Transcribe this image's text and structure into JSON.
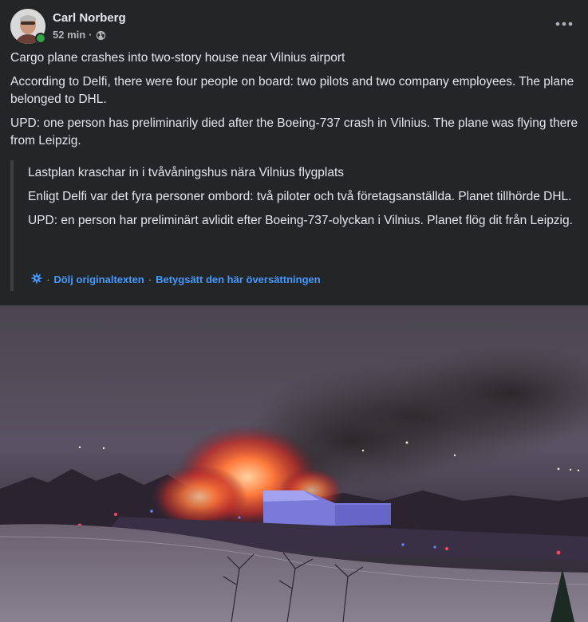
{
  "post": {
    "author": "Carl Norberg",
    "time": "52 min",
    "separator": "·",
    "privacy_icon": "globe-icon",
    "more_icon": "more-options-icon",
    "body": [
      "Cargo plane crashes into two-story house near Vilnius airport",
      "According to Delfi, there were four people on board: two pilots and two company employees. The plane belonged to DHL.",
      "UPD: one person has preliminarily died after the Boeing-737 crash in Vilnius. The plane was flying there from Leipzig."
    ],
    "original": [
      "Lastplan kraschar in i tvåvåningshus nära Vilnius flygplats",
      "Enligt Delfi var det fyra personer ombord: två piloter och två företagsanställda. Planet tillhörde DHL.",
      "UPD: en person har preliminärt avlidit efter Boeing-737-olyckan i Vilnius. Planet flög dit från Leipzig."
    ],
    "translation_links": {
      "settings_icon": "gear-icon",
      "dot": "·",
      "hide_original": "Dölj originaltexten",
      "rate_translation": "Betygsätt den här översättningen"
    }
  },
  "colors": {
    "background": "#242526",
    "text": "#e4e6eb",
    "secondary_text": "#b0b3b8",
    "link": "#4599ff",
    "online": "#31a24c"
  }
}
